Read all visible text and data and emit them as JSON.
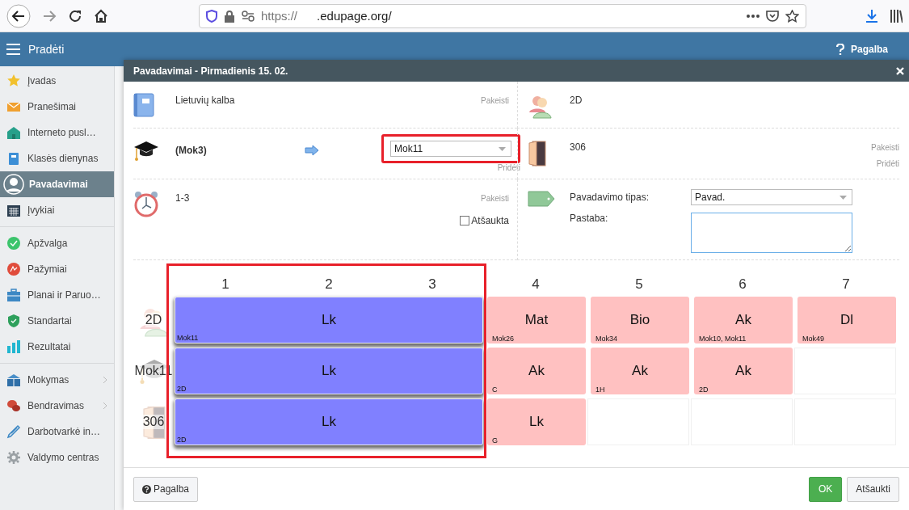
{
  "browser": {
    "url_scheme": "https://",
    "url_domain": ".edupage.org/"
  },
  "app_bar": {
    "menu_label": "Pradėti",
    "help_label": "Pagalba"
  },
  "sidebar": {
    "groups": [
      {
        "items": [
          {
            "label": "Įvadas",
            "selected": false,
            "expandable": false
          },
          {
            "label": "Pranešimai",
            "selected": false,
            "expandable": false
          },
          {
            "label": "Interneto pusl…",
            "selected": false,
            "expandable": false
          },
          {
            "label": "Klasės dienynas",
            "selected": false,
            "expandable": false
          },
          {
            "label": "Pavadavimai",
            "selected": true,
            "expandable": false
          },
          {
            "label": "Įvykiai",
            "selected": false,
            "expandable": false
          }
        ]
      },
      {
        "items": [
          {
            "label": "Apžvalga",
            "selected": false,
            "expandable": false
          },
          {
            "label": "Pažymiai",
            "selected": false,
            "expandable": false
          },
          {
            "label": "Planai ir Paruo…",
            "selected": false,
            "expandable": false
          },
          {
            "label": "Standartai",
            "selected": false,
            "expandable": false
          },
          {
            "label": "Rezultatai",
            "selected": false,
            "expandable": false
          }
        ]
      },
      {
        "items": [
          {
            "label": "Mokymas",
            "selected": false,
            "expandable": true
          },
          {
            "label": "Bendravimas",
            "selected": false,
            "expandable": true
          },
          {
            "label": "Darbotvarkė in…",
            "selected": false,
            "expandable": false
          },
          {
            "label": "Valdymo centras",
            "selected": false,
            "expandable": false
          }
        ]
      }
    ]
  },
  "dialog": {
    "title": "Pavadavimai - Pirmadienis 15. 02.",
    "subject": {
      "value": "Lietuvių kalba",
      "action": "Pakeisti"
    },
    "class": {
      "value": "2D"
    },
    "teacher": {
      "original": "(Mok3)",
      "replacement": "Mok11",
      "highlighted": true,
      "action": "Pridėti"
    },
    "room": {
      "value": "306",
      "actions": [
        "Pakeisti",
        "Pridėti"
      ]
    },
    "period": {
      "value": "1-3",
      "action": "Pakeisti",
      "cancelled_label": "Atšaukta",
      "cancelled": false
    },
    "type": {
      "label": "Pavadavimo tipas:",
      "value": "Pavad.",
      "note_label": "Pastaba:"
    },
    "timetable": {
      "columns": [
        "1",
        "2",
        "3",
        "4",
        "5",
        "6",
        "7"
      ],
      "highlighted": true,
      "rows": [
        {
          "label": "2D",
          "kind": "class",
          "substitution": {
            "subject": "Lk",
            "info": "Mok11"
          },
          "lessons": [
            {
              "kind": "lesson",
              "subject": "Mat",
              "info": "Mok26"
            },
            {
              "kind": "lesson",
              "subject": "Bio",
              "info": "Mok34"
            },
            {
              "kind": "lesson",
              "subject": "Ak",
              "info": "Mok10, Mok11"
            },
            {
              "kind": "lesson",
              "subject": "Dl",
              "info": "Mok49"
            }
          ]
        },
        {
          "label": "Mok11",
          "kind": "teacher",
          "substitution": {
            "subject": "Lk",
            "info": "2D"
          },
          "lessons": [
            {
              "kind": "lesson",
              "subject": "Ak",
              "info": "C"
            },
            {
              "kind": "lesson",
              "subject": "Ak",
              "info": "1H"
            },
            {
              "kind": "lesson",
              "subject": "Ak",
              "info": "2D"
            },
            {
              "kind": "empty"
            }
          ]
        },
        {
          "label": "306",
          "kind": "room",
          "substitution": {
            "subject": "Lk",
            "info": "2D"
          },
          "lessons": [
            {
              "kind": "lesson",
              "subject": "Lk",
              "info": "G"
            },
            {
              "kind": "empty"
            },
            {
              "kind": "empty"
            },
            {
              "kind": "empty"
            }
          ]
        }
      ]
    },
    "footer": {
      "help_button": "Pagalba",
      "ok_button": "OK",
      "cancel_button": "Atšaukti"
    }
  }
}
